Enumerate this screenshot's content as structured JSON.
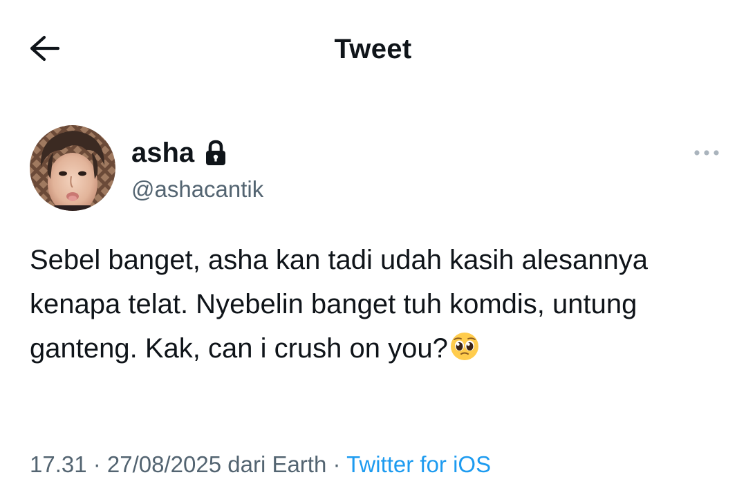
{
  "header": {
    "title": "Tweet",
    "back_icon": "arrow-left-icon"
  },
  "tweet": {
    "author": {
      "display_name": "asha",
      "handle": "@ashacantik",
      "protected_icon": "lock-icon"
    },
    "more_icon": "ellipsis-icon",
    "text": "Sebel banget, asha kan tadi udah kasih alesannya kenapa telat. Nyebelin banget tuh komdis, untung ganteng. Kak, can i crush on you?",
    "text_emoji": "pleading-face-emoji",
    "meta": {
      "time": "17.31",
      "separator": " · ",
      "date_location": "27/08/2025 dari Earth",
      "source": "Twitter for iOS"
    }
  },
  "colors": {
    "text_primary": "#0f1419",
    "text_secondary": "#536471",
    "link": "#1d9bf0",
    "background": "#ffffff"
  }
}
